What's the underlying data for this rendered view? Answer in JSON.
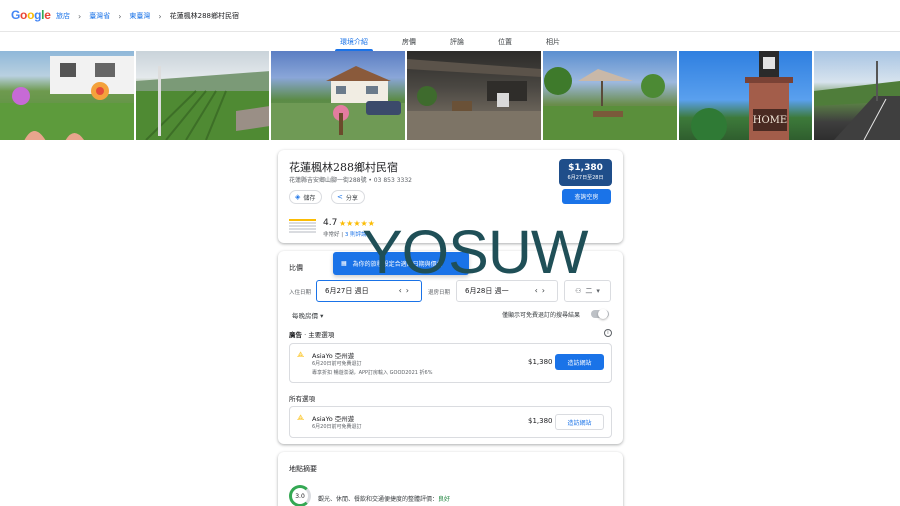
{
  "logo": {
    "letters": [
      "G",
      "o",
      "o",
      "g",
      "l",
      "e"
    ],
    "colors": [
      "#4285f4",
      "#ea4335",
      "#fbbc04",
      "#4285f4",
      "#34a853",
      "#ea4335"
    ]
  },
  "breadcrumbs": [
    "旅店",
    "臺灣省",
    "東臺灣",
    "花蓮楓林288鄉村民宿"
  ],
  "breadcrumb_sep": "›",
  "tabs": [
    "環境介紹",
    "房價",
    "評論",
    "位置",
    "相片"
  ],
  "active_tab": "環境介紹",
  "hotel": {
    "name": "花蓮楓林288鄉村民宿",
    "address_phone": "花蓮縣吉安鄉山腳一街288號 • 03 853 3332",
    "save_label": "儲存",
    "share_label": "分享",
    "price": "$1,380",
    "price_dates": "6月27日至28日",
    "check_button": "查詢空房",
    "rating": "4.7",
    "stars": "★★★★★",
    "rating_desc": "非常好",
    "reviews_link": "3 則評論"
  },
  "compare": {
    "title": "比價",
    "tooltip": "為你的旅程設定合適的日期與價格",
    "checkin_label": "入住日期",
    "checkin_value": "6月27日 週日",
    "checkout_label": "退房日期",
    "checkout_value": "6月28日 週一",
    "guests": "二",
    "nightly_label": "每晚房價",
    "free_cancel_label": "僅顯示可免費退訂的搜尋結果",
    "ads_label": "廣告",
    "ads_sub": "· 主要選項",
    "all_options_label": "所有選項",
    "offers": [
      {
        "name": "AsiaYo 亞州遊",
        "sub": "6月20日前可免費退訂",
        "sub2": "專享折扣 暢遊澎湖，APP訂房輸入 GOOD2021 折6%",
        "price": "$1,380",
        "button": "造訪網站"
      },
      {
        "name": "AsiaYo 亞州遊",
        "sub": "6月20日前可免費退訂",
        "price": "$1,380",
        "button": "造訪網站"
      }
    ]
  },
  "location": {
    "title": "地點摘要",
    "score": "3.0",
    "text": "觀光、休閒、餐飲和交通便捷度的整體評價：",
    "rating_word": "良好"
  },
  "watermark": "YOSUW",
  "colors": {
    "accent": "#1a73e8",
    "price_bg": "#1f4e8a",
    "star": "#fbbc04",
    "good": "#188038"
  }
}
